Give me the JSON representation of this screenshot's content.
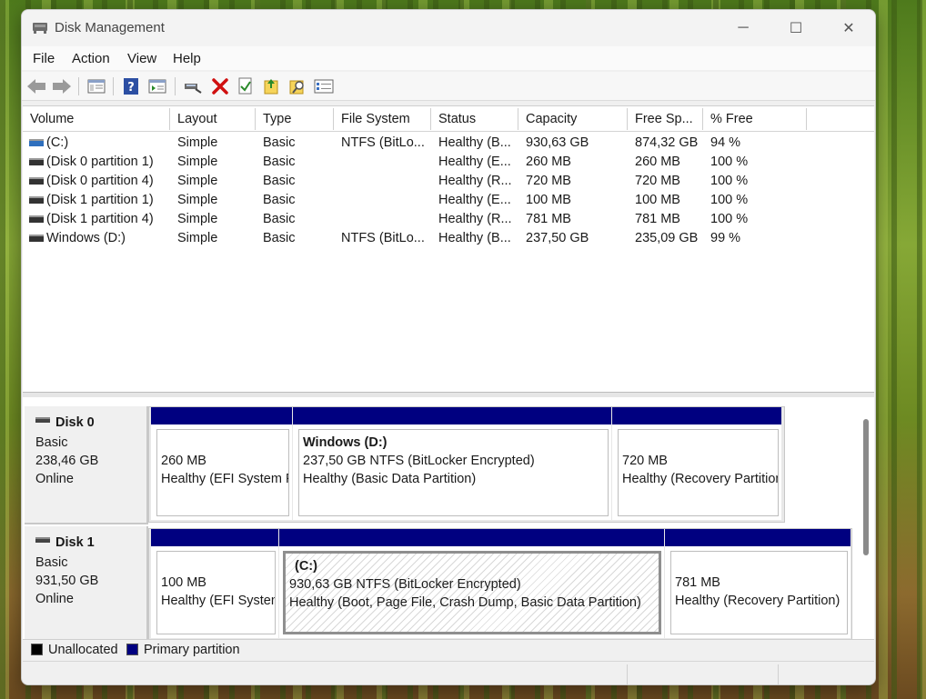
{
  "window": {
    "title": "Disk Management",
    "app_icon": "disk-management-icon"
  },
  "window_controls": {
    "minimize": "─",
    "maximize": "☐",
    "close": "✕"
  },
  "menu": [
    "File",
    "Action",
    "View",
    "Help"
  ],
  "toolbar_icons": [
    "back-arrow-icon",
    "forward-arrow-icon",
    "console-tree-icon",
    "help-icon",
    "properties-pane-icon",
    "connect-disk-icon",
    "delete-icon",
    "checkmark-icon",
    "open-folder-icon",
    "search-folder-icon",
    "properties-list-icon"
  ],
  "volume_list": {
    "columns": [
      "Volume",
      "Layout",
      "Type",
      "File System",
      "Status",
      "Capacity",
      "Free Sp...",
      "% Free"
    ],
    "rows": [
      {
        "volume": " (C:)",
        "layout": "Simple",
        "type": "Basic",
        "fs": "NTFS (BitLo...",
        "status": "Healthy (B...",
        "capacity": "930,63 GB",
        "free": "874,32 GB",
        "pct": "94 %",
        "icon": "system-volume-icon",
        "icon_color": "#2f6fbd"
      },
      {
        "volume": "(Disk 0 partition 1)",
        "layout": "Simple",
        "type": "Basic",
        "fs": "",
        "status": "Healthy (E...",
        "capacity": "260 MB",
        "free": "260 MB",
        "pct": "100 %",
        "icon": "volume-icon",
        "icon_color": "#333333"
      },
      {
        "volume": "(Disk 0 partition 4)",
        "layout": "Simple",
        "type": "Basic",
        "fs": "",
        "status": "Healthy (R...",
        "capacity": "720 MB",
        "free": "720 MB",
        "pct": "100 %",
        "icon": "volume-icon",
        "icon_color": "#333333"
      },
      {
        "volume": "(Disk 1 partition 1)",
        "layout": "Simple",
        "type": "Basic",
        "fs": "",
        "status": "Healthy (E...",
        "capacity": "100 MB",
        "free": "100 MB",
        "pct": "100 %",
        "icon": "volume-icon",
        "icon_color": "#333333"
      },
      {
        "volume": "(Disk 1 partition 4)",
        "layout": "Simple",
        "type": "Basic",
        "fs": "",
        "status": "Healthy (R...",
        "capacity": "781 MB",
        "free": "781 MB",
        "pct": "100 %",
        "icon": "volume-icon",
        "icon_color": "#333333"
      },
      {
        "volume": "Windows (D:)",
        "layout": "Simple",
        "type": "Basic",
        "fs": "NTFS (BitLo...",
        "status": "Healthy (B...",
        "capacity": "237,50 GB",
        "free": "235,09 GB",
        "pct": "99 %",
        "icon": "volume-icon",
        "icon_color": "#333333"
      }
    ]
  },
  "disks": [
    {
      "name": "Disk 0",
      "type": "Basic",
      "size": "238,46 GB",
      "state": "Online",
      "partitions": [
        {
          "title": "",
          "size": "260 MB",
          "status": "Healthy (EFI System P"
        },
        {
          "title": "Windows  (D:)",
          "size": "237,50 GB NTFS (BitLocker Encrypted)",
          "status": "Healthy (Basic Data Partition)"
        },
        {
          "title": "",
          "size": "720 MB",
          "status": "Healthy (Recovery Partition)"
        }
      ]
    },
    {
      "name": "Disk 1",
      "type": "Basic",
      "size": "931,50 GB",
      "state": "Online",
      "partitions": [
        {
          "title": "",
          "size": "100 MB",
          "status": "Healthy (EFI System"
        },
        {
          "title": "(C:)",
          "size": "930,63 GB NTFS (BitLocker Encrypted)",
          "status": "Healthy (Boot, Page File, Crash Dump, Basic Data Partition)",
          "selected": true
        },
        {
          "title": "",
          "size": "781 MB",
          "status": "Healthy (Recovery Partition)"
        }
      ]
    }
  ],
  "legend": [
    {
      "label": "Unallocated",
      "color": "#000000"
    },
    {
      "label": "Primary partition",
      "color": "#000080"
    }
  ],
  "colors": {
    "primary_partition": "#000080",
    "unallocated": "#000000",
    "selection_hatch": "#8f8f8f"
  }
}
